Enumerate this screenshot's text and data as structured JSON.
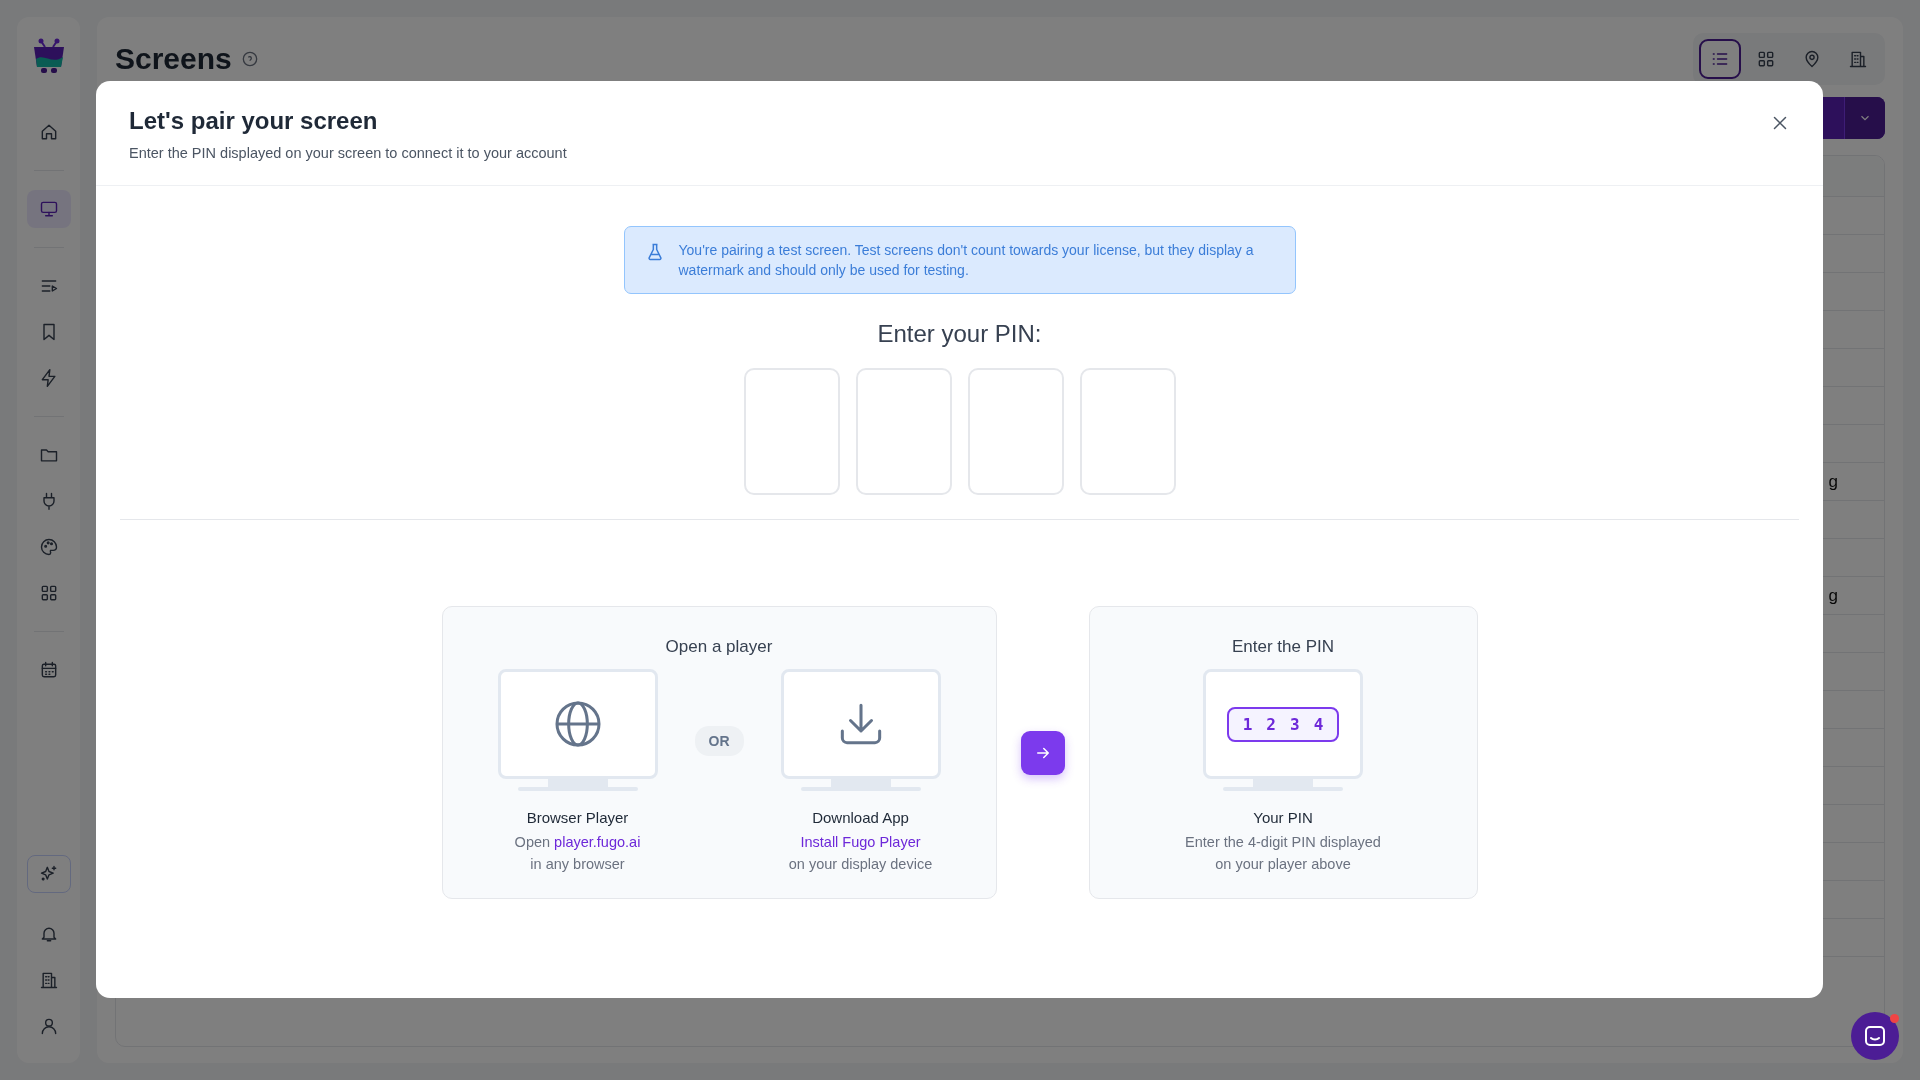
{
  "sidebar": {
    "items": [
      {
        "selected": false
      },
      {
        "selected": true
      },
      {
        "selected": false
      },
      {
        "selected": false
      },
      {
        "selected": false
      },
      {
        "selected": false
      },
      {
        "selected": false
      },
      {
        "selected": false
      },
      {
        "selected": false
      },
      {
        "selected": false
      },
      {
        "selected": false
      },
      {
        "selected": false
      },
      {
        "selected": false
      },
      {
        "selected": false
      }
    ]
  },
  "page": {
    "title": "Screens",
    "view_toggles": [
      {
        "selected": true
      },
      {
        "selected": false
      },
      {
        "selected": false
      },
      {
        "selected": false
      }
    ],
    "table_rows": [
      {},
      {},
      {},
      {},
      {},
      {},
      {},
      {
        "cell": "g"
      },
      {},
      {},
      {
        "cell": "g"
      },
      {},
      {},
      {},
      {},
      {},
      {},
      {},
      {},
      {}
    ]
  },
  "modal": {
    "title": "Let's pair your screen",
    "subtitle": "Enter the PIN displayed on your screen to connect it to your account",
    "notice": "You're pairing a test screen. Test screens don't count towards your license, but they display a watermark and should only be used for testing.",
    "pin_label": "Enter your PIN:",
    "pin_fields": [
      {
        "filled": false
      },
      {
        "filled": false
      },
      {
        "filled": false
      },
      {
        "filled": false
      }
    ],
    "steps": [
      {
        "title": "Open a player",
        "separator": "OR",
        "options": [
          {
            "kind": "globe",
            "title": "Browser Player",
            "lines": [
              [
                {
                  "text": "Open "
                },
                {
                  "text": "player.fugo.ai",
                  "link": true
                }
              ],
              [
                {
                  "text": "in any browser"
                }
              ]
            ]
          },
          {
            "kind": "download",
            "title": "Download App",
            "lines": [
              [
                {
                  "text": "Install Fugo Player",
                  "link": true
                }
              ],
              [
                {
                  "text": "on your display device"
                }
              ]
            ]
          }
        ]
      },
      {
        "title": "Enter the PIN",
        "options": [
          {
            "kind": "pin",
            "digits": [
              "1",
              "2",
              "3",
              "4"
            ],
            "title": "Your PIN",
            "lines": [
              [
                {
                  "text": "Enter the 4-digit PIN displayed"
                }
              ],
              [
                {
                  "text": "on your player above"
                }
              ]
            ]
          }
        ]
      }
    ]
  },
  "chat": {
    "unread": true
  }
}
